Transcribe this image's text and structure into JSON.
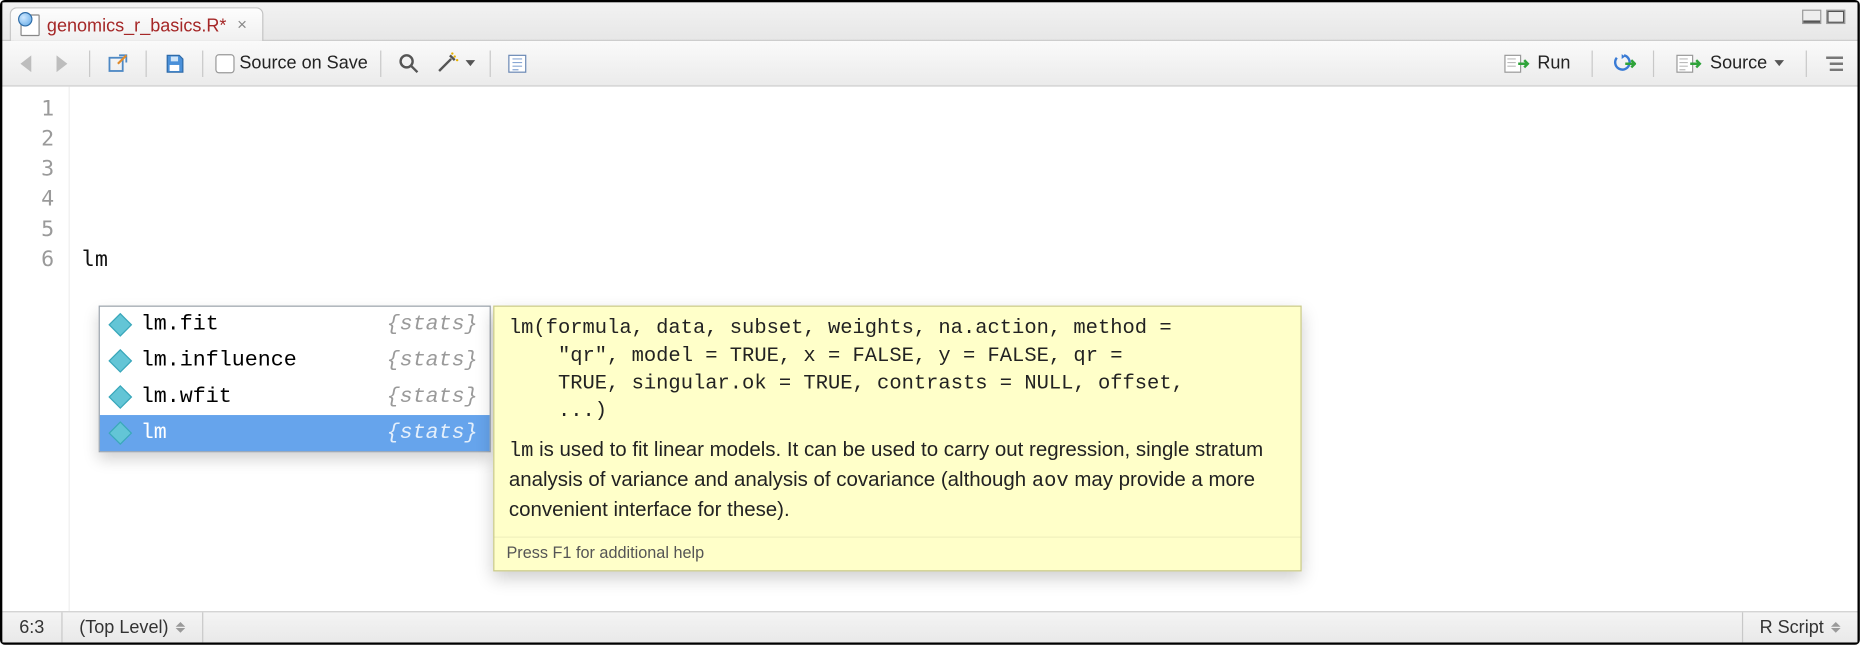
{
  "tab": {
    "filename": "genomics_r_basics.R*"
  },
  "toolbar": {
    "source_on_save_label": "Source on Save",
    "run_label": "Run",
    "source_label": "Source"
  },
  "editor": {
    "gutter_lines": [
      "1",
      "2",
      "3",
      "4",
      "5",
      "6"
    ],
    "code_lines": [
      "",
      "",
      "",
      "",
      "",
      "lm"
    ]
  },
  "autocomplete": {
    "items": [
      {
        "name": "lm.fit",
        "pkg": "{stats}",
        "selected": false
      },
      {
        "name": "lm.influence",
        "pkg": "{stats}",
        "selected": false
      },
      {
        "name": "lm.wfit",
        "pkg": "{stats}",
        "selected": false
      },
      {
        "name": "lm",
        "pkg": "{stats}",
        "selected": true
      }
    ],
    "tooltip": {
      "signature": "lm(formula, data, subset, weights, na.action, method =\n    \"qr\", model = TRUE, x = FALSE, y = FALSE, qr =\n    TRUE, singular.ok = TRUE, contrasts = NULL, offset,\n    ...)",
      "desc_prefix_code": "lm",
      "desc_body_1": " is used to fit linear models. It can be used to carry out regression, single stratum analysis of variance and analysis of covariance (although ",
      "desc_code_2": "aov",
      "desc_body_2": " may provide a more convenient interface for these).",
      "footer": "Press F1 for additional help"
    }
  },
  "status": {
    "cursor": "6:3",
    "scope": "(Top Level)",
    "mode": "R Script"
  }
}
